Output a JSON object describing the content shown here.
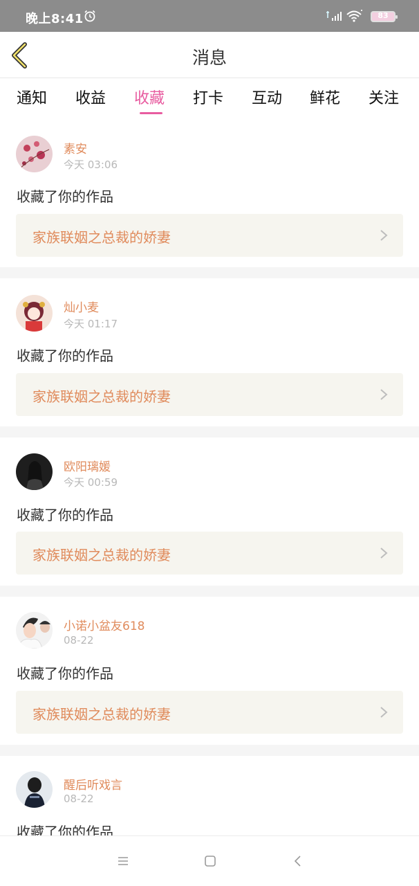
{
  "status_bar": {
    "time": "晚上8:41",
    "battery": "83"
  },
  "header": {
    "title": "消息"
  },
  "tabs": [
    {
      "label": "通知",
      "active": false
    },
    {
      "label": "收益",
      "active": false
    },
    {
      "label": "收藏",
      "active": true
    },
    {
      "label": "打卡",
      "active": false
    },
    {
      "label": "互动",
      "active": false
    },
    {
      "label": "鲜花",
      "active": false
    },
    {
      "label": "关注",
      "active": false
    }
  ],
  "messages": [
    {
      "user": "素安",
      "time": "今天 03:06",
      "action": "收藏了你的作品",
      "work_title": "家族联姻之总裁的娇妻"
    },
    {
      "user": "灿小麦",
      "time": "今天 01:17",
      "action": "收藏了你的作品",
      "work_title": "家族联姻之总裁的娇妻"
    },
    {
      "user": "欧阳璃媛",
      "time": "今天 00:59",
      "action": "收藏了你的作品",
      "work_title": "家族联姻之总裁的娇妻"
    },
    {
      "user": "小诺小盆友618",
      "time": "08-22",
      "action": "收藏了你的作品",
      "work_title": "家族联姻之总裁的娇妻"
    },
    {
      "user": "醒后听戏言",
      "time": "08-22",
      "action": "收藏了你的作品",
      "work_title": ""
    }
  ],
  "colors": {
    "accent": "#e85ca0",
    "name": "#e08b5c",
    "card_bg": "#f6f5ef"
  }
}
